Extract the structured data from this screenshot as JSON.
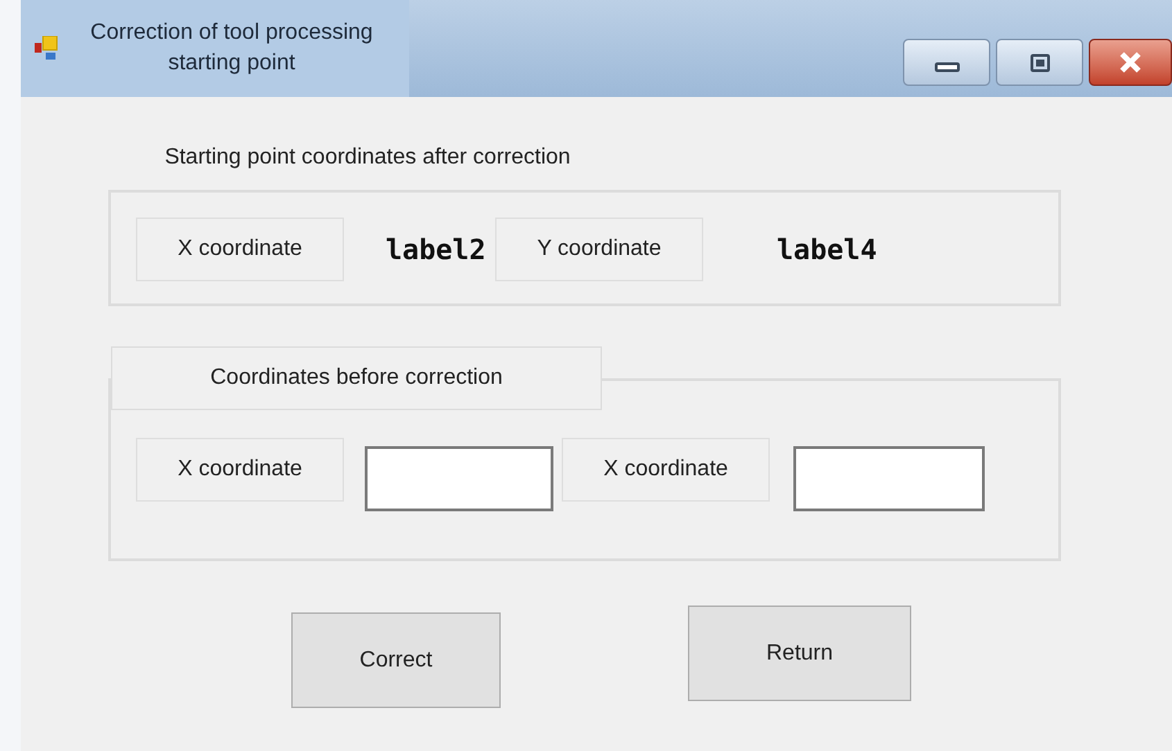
{
  "window": {
    "title": "Correction of tool processing starting point"
  },
  "result_group": {
    "legend": "Starting point coordinates after correction",
    "x_label": "X coordinate",
    "x_value": "label2",
    "y_label": "Y coordinate",
    "y_value": "label4"
  },
  "input_group": {
    "legend": "Coordinates before correction",
    "fields": [
      {
        "label": "X coordinate"
      },
      {
        "label": "X coordinate"
      }
    ]
  },
  "buttons": [
    "Correct",
    "Return"
  ]
}
